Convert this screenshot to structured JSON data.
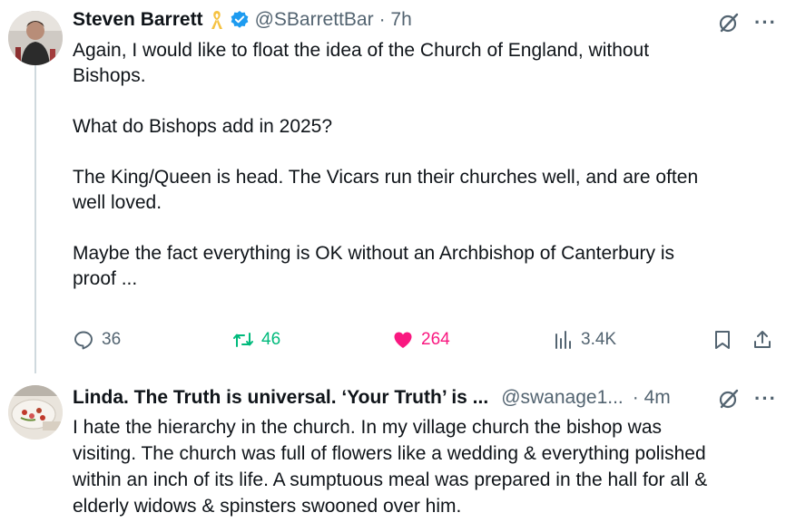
{
  "tweet": {
    "author_name": "Steven Barrett",
    "handle": "@SBarrettBar",
    "time": "· 7h",
    "text": "Again, I would like to float the idea of the Church of England, without\nBishops.\n\nWhat do Bishops add in 2025?\n\nThe King/Queen is head. The Vicars run their churches well, and are often\nwell loved.\n\nMaybe the fact everything is OK without an Archbishop of Canterbury is\nproof ...",
    "replies": "36",
    "retweets": "46",
    "likes": "264",
    "views": "3.4K"
  },
  "reply": {
    "author_name": "Linda. The Truth is universal. ‘Your Truth’ is ...",
    "handle": "@swanage1...",
    "time": "· 4m",
    "text": "I hate the hierarchy in the church. In my village church the bishop was\nvisiting. The church was full of flowers like a wedding & everything polished\nwithin an inch of its life. A sumptuous meal was prepared in the hall for all &\nelderly widows & spinsters swooned over him."
  },
  "icons": {
    "ribbon": "yellow-ribbon-icon",
    "verified": "verified-badge-icon",
    "grok": "grok-icon",
    "more": "more-icon",
    "reply": "reply-icon",
    "retweet": "retweet-icon",
    "like": "heart-icon",
    "views": "views-icon",
    "bookmark": "bookmark-icon",
    "share": "share-icon"
  },
  "colors": {
    "text": "#0f1419",
    "secondary": "#536471",
    "verified": "#1d9bf0",
    "retweet": "#00ba7c",
    "like": "#f91880",
    "ribbon": "#f5c242"
  }
}
